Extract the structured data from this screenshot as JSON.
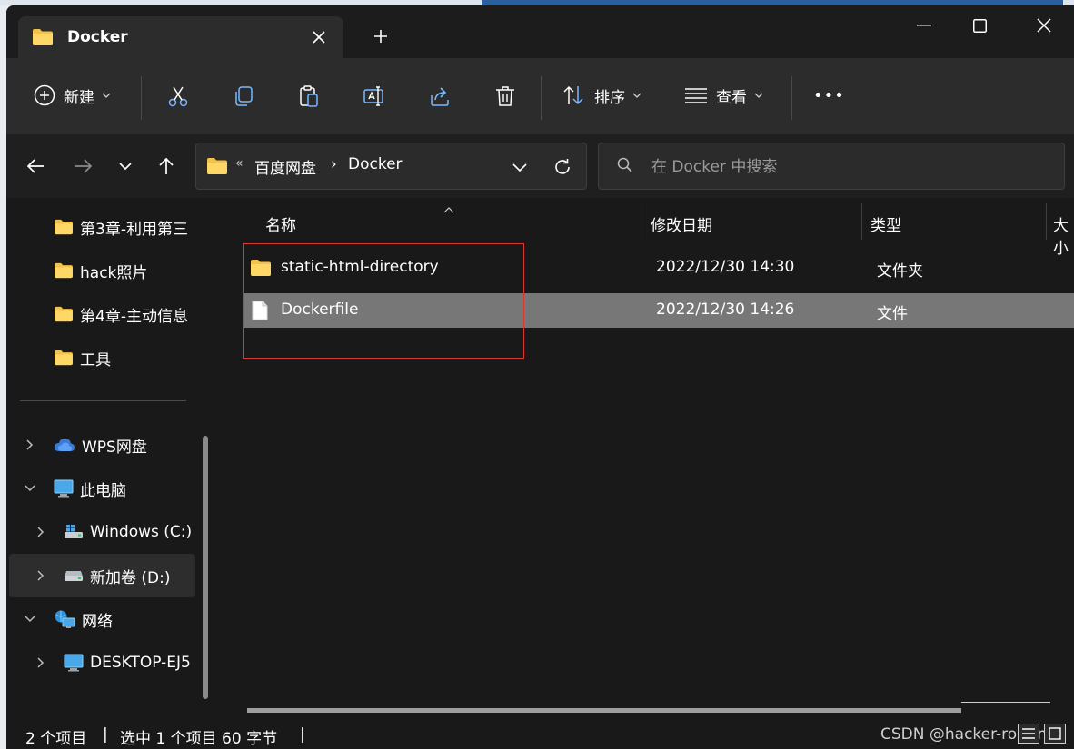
{
  "window": {
    "tab_title": "Docker",
    "new_tab_symbol": "+",
    "controls": [
      "minimize",
      "maximize",
      "close"
    ]
  },
  "toolbar": {
    "new_label": "新建",
    "sort_label": "排序",
    "view_label": "查看",
    "actions": [
      "cut-icon",
      "copy-icon",
      "paste-icon",
      "rename-icon",
      "share-icon",
      "delete-icon"
    ],
    "more_symbol": "•••"
  },
  "address": {
    "overflow": "«",
    "crumbs": [
      "百度网盘",
      "Docker"
    ],
    "crumb_separator": "›"
  },
  "search": {
    "placeholder": "在 Docker 中搜索"
  },
  "sidebar": {
    "quick_items": [
      {
        "label": "第3章-利用第三",
        "icon": "folder-icon"
      },
      {
        "label": "hack照片",
        "icon": "folder-icon"
      },
      {
        "label": "第4章-主动信息",
        "icon": "folder-icon"
      },
      {
        "label": "工具",
        "icon": "folder-icon"
      }
    ],
    "tree_items": [
      {
        "label": "WPS网盘",
        "icon": "cloud-icon",
        "expander": "collapsed"
      },
      {
        "label": "此电脑",
        "icon": "computer-icon",
        "expander": "expanded"
      },
      {
        "label": "Windows  (C:)",
        "icon": "windows-drive-icon",
        "expander": "collapsed"
      },
      {
        "label": "新加卷 (D:)",
        "icon": "drive-icon",
        "expander": "collapsed",
        "selected": true
      },
      {
        "label": "网络",
        "icon": "network-icon",
        "expander": "expanded"
      },
      {
        "label": "DESKTOP-EJ5",
        "icon": "computer-icon",
        "expander": "collapsed"
      }
    ]
  },
  "content": {
    "columns": [
      "名称",
      "修改日期",
      "类型",
      "大小"
    ],
    "rows": [
      {
        "name": "static-html-directory",
        "date": "2022/12/30 14:30",
        "type": "文件夹",
        "icon": "folder-icon",
        "selected": false
      },
      {
        "name": "Dockerfile",
        "date": "2022/12/30 14:26",
        "type": "文件",
        "icon": "file-icon",
        "selected": true
      }
    ]
  },
  "status": {
    "count": "2 个项目",
    "selection": "选中 1 个项目  60 字节",
    "separator": "|",
    "watermark": "CSDN @hacker-routing"
  },
  "colors": {
    "accent_folder": "#f3c24a",
    "selection_highlight": "#777777",
    "annotation_box": "#d9372f",
    "background": "#191919"
  }
}
